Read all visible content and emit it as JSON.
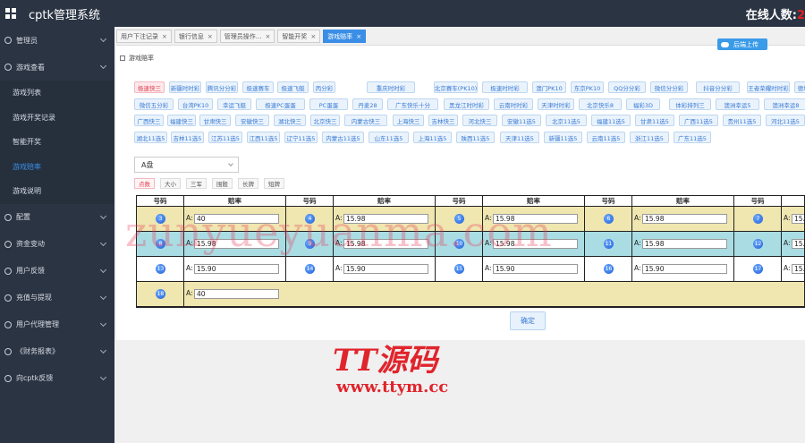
{
  "app": {
    "title": "cptk管理系统",
    "online_label": "在线人数:",
    "online_value": "2"
  },
  "sidebar": {
    "items": [
      {
        "label": "管理员",
        "expandable": true
      },
      {
        "label": "游戏查看",
        "expandable": true
      },
      {
        "label": "游戏列表",
        "sub": true
      },
      {
        "label": "游戏开奖记录",
        "sub": true
      },
      {
        "label": "智能开奖",
        "sub": true
      },
      {
        "label": "游戏赔率",
        "sub": true,
        "active": true
      },
      {
        "label": "游戏说明",
        "sub": true
      },
      {
        "label": "配置",
        "expandable": true
      },
      {
        "label": "资金变动",
        "expandable": true
      },
      {
        "label": "用户反馈",
        "expandable": true
      },
      {
        "label": "充值与提现",
        "expandable": true
      },
      {
        "label": "用户代理管理",
        "expandable": true
      },
      {
        "label": "《财务报表》",
        "expandable": true
      },
      {
        "label": "向cptk反馈",
        "expandable": true
      }
    ]
  },
  "tabs": [
    {
      "label": "用户下注记录",
      "close": "×"
    },
    {
      "label": "银行信息",
      "close": "×"
    },
    {
      "label": "管理员操作...",
      "close": "×"
    },
    {
      "label": "智能开奖",
      "close": "×"
    },
    {
      "label": "游戏赔率",
      "close": "×",
      "active": true
    }
  ],
  "panel": {
    "title": "游戏赔率",
    "platform_button": "后端上传"
  },
  "lotteries": [
    [
      "极速快三",
      "新疆时时彩",
      "腾讯分分彩",
      "极速赛车",
      "极速飞艇",
      "丙分彩",
      "重庆时时彩",
      "北京赛车(PK10)",
      "极速时时彩",
      "澳门PK10",
      "东京PK10",
      "QQ分分彩",
      "微信分分彩",
      "抖音分分彩",
      "王者荣耀时时彩",
      "德地求生时"
    ],
    [
      "微信五分彩",
      "台湾PK10",
      "幸运飞艇",
      "极速PC蛋蛋",
      "PC蛋蛋",
      "丹麦28",
      "广东快乐十分",
      "黑龙江时时彩",
      "云南时时彩",
      "天津时时彩",
      "北京快乐8",
      "福彩3D",
      "体彩排列三",
      "澳洲幸运5",
      "澳洲幸运8",
      "澳洲幸运10",
      "澳"
    ],
    [
      "广西快三",
      "福建快三",
      "甘肃快三",
      "安徽快三",
      "湖北快三",
      "北京快三",
      "内蒙古快三",
      "上海快三",
      "吉林快三",
      "河北快三",
      "安徽11选5",
      "北京11选5",
      "福建11选5",
      "甘肃11选5",
      "广西11选5",
      "贵州11选5",
      "河北11选5"
    ],
    [
      "湖北11选5",
      "吉林11选5",
      "江苏11选5",
      "江西11选5",
      "辽宁11选5",
      "内蒙古11选5",
      "山东11选5",
      "上海11选5",
      "陕西11选5",
      "天津11选5",
      "新疆11选5",
      "云南11选5",
      "浙江11选5",
      "广东11选5"
    ]
  ],
  "selected_lottery": "极速快三",
  "plate_select": "A盘",
  "bet_categories": [
    {
      "label": "点数",
      "selected": true
    },
    {
      "label": "大小"
    },
    {
      "label": "三军"
    },
    {
      "label": "围骰"
    },
    {
      "label": "长牌"
    },
    {
      "label": "短牌"
    }
  ],
  "odds_table": {
    "header_number": "号码",
    "header_odds": "赔率",
    "plate_label": "A:",
    "rows": [
      [
        {
          "num": "3",
          "odds": "40"
        },
        {
          "num": "4",
          "odds": "15.98"
        },
        {
          "num": "5",
          "odds": "15.98"
        },
        {
          "num": "6",
          "odds": "15.98"
        },
        {
          "num": "7",
          "odds": "15.9"
        }
      ],
      [
        {
          "num": "8",
          "odds": "15.98"
        },
        {
          "num": "9",
          "odds": "15.98"
        },
        {
          "num": "10",
          "odds": "15.98"
        },
        {
          "num": "11",
          "odds": "15.98"
        },
        {
          "num": "12",
          "odds": "15.9"
        }
      ],
      [
        {
          "num": "13",
          "odds": "15.90"
        },
        {
          "num": "14",
          "odds": "15.90"
        },
        {
          "num": "15",
          "odds": "15.90"
        },
        {
          "num": "16",
          "odds": "15.90"
        },
        {
          "num": "17",
          "odds": "15.9"
        }
      ],
      [
        {
          "num": "18",
          "odds": "40"
        }
      ]
    ],
    "row_colors": [
      "#efe6b0",
      "#a9dde3",
      "#ffffff",
      "#efe6b0"
    ]
  },
  "confirm_label": "确定",
  "watermarks": {
    "main": "zunyueyuanma.com",
    "brand": "TT源码",
    "url": "www.ttym.cc"
  }
}
